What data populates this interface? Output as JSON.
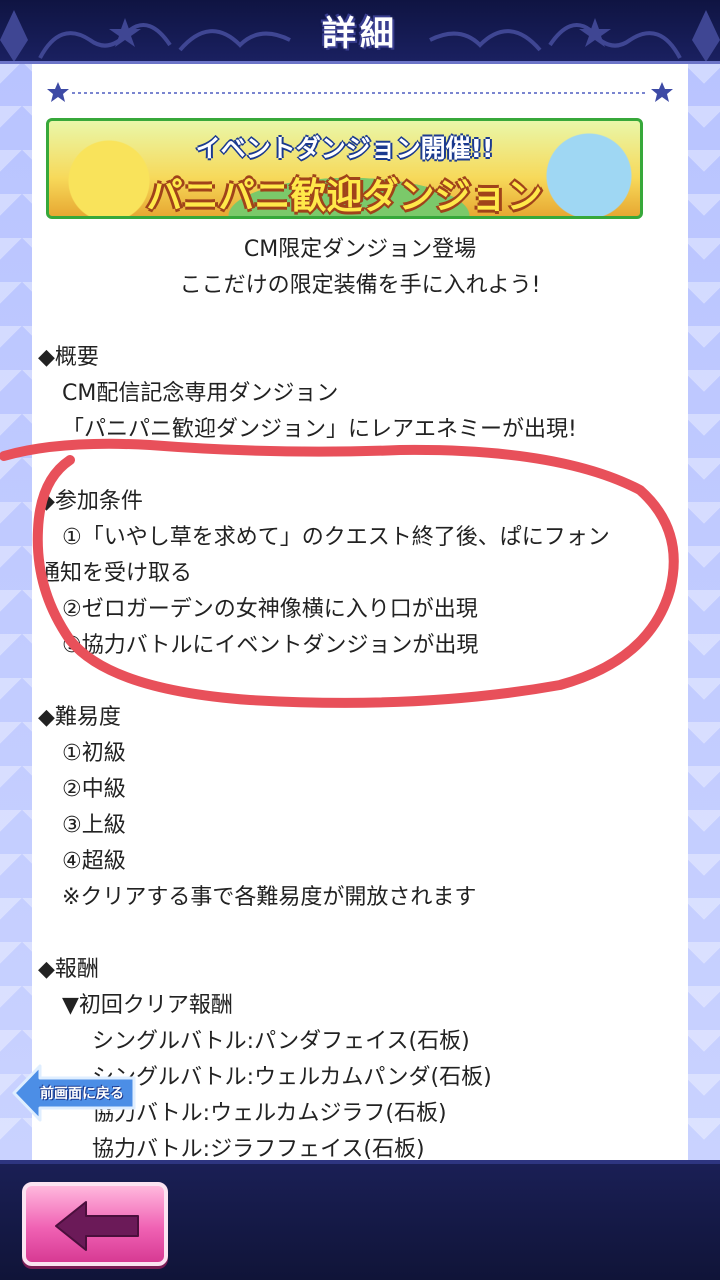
{
  "header": {
    "title": "詳細"
  },
  "banner": {
    "line1": "イベントダンジョン開催!!",
    "line2": "パニパニ歓迎ダンジョン"
  },
  "intro": {
    "line1": "CM限定ダンジョン登場",
    "line2": "ここだけの限定装備を手に入れよう!"
  },
  "sections": {
    "overview": {
      "heading": "◆概要",
      "lines": [
        "CM配信記念専用ダンジョン",
        "「パニパニ歓迎ダンジョン」にレアエネミーが出現!"
      ]
    },
    "conditions": {
      "heading": "◆参加条件",
      "lines": [
        "①「いやし草を求めて」のクエスト終了後、ぱにフォン",
        "通知を受け取る",
        "②ゼロガーデンの女神像横に入り口が出現",
        "③協力バトルにイベントダンジョンが出現"
      ]
    },
    "difficulty": {
      "heading": "◆難易度",
      "lines": [
        "①初級",
        "②中級",
        "③上級",
        "④超級",
        "※クリアする事で各難易度が開放されます"
      ]
    },
    "rewards": {
      "heading": "◆報酬",
      "subheading": "▼初回クリア報酬",
      "lines": [
        "シングルバトル:パンダフェイス(石板)",
        "シングルバトル:ウェルカムパンダ(石板)",
        "協力バトル:ウェルカムジラフ(石板)",
        "協力バトル:ジラフフェイス(石板)"
      ]
    }
  },
  "floating_back": {
    "label": "前画面に戻る"
  },
  "colors": {
    "annotation": "#e8505a",
    "header_bg": "#0f1442",
    "back_button": "#f062b4"
  },
  "icons": {
    "back": "left-arrow-icon",
    "star": "star-icon"
  }
}
